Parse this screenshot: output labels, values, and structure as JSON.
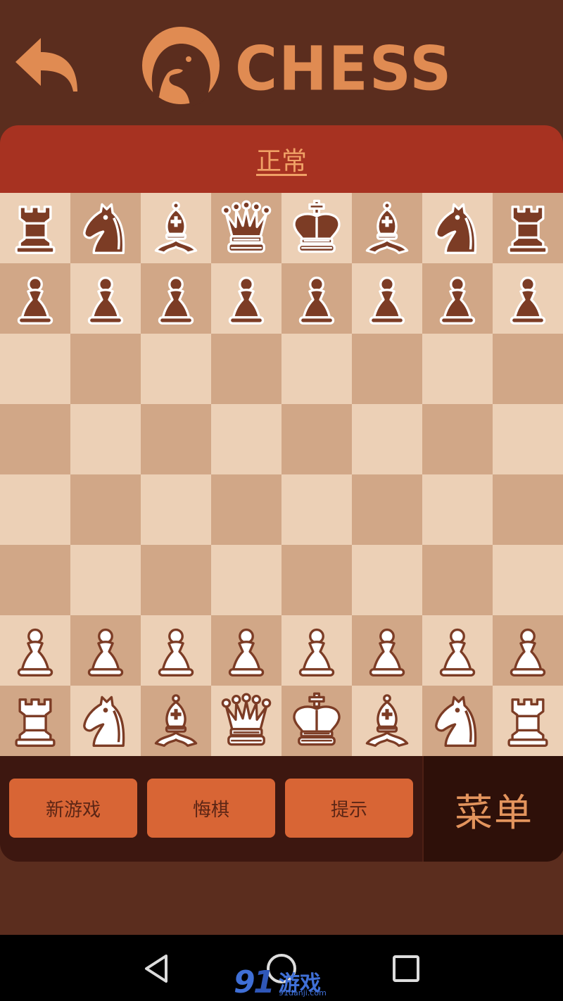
{
  "header": {
    "back_icon": "back-arrow-icon",
    "logo_icon": "horse-head-logo-icon",
    "logo_text": "CHESS"
  },
  "mode": {
    "label": "正常"
  },
  "board": {
    "rows": [
      [
        "br",
        "bn",
        "bb",
        "bq",
        "bk",
        "bb",
        "bn",
        "br"
      ],
      [
        "bp",
        "bp",
        "bp",
        "bp",
        "bp",
        "bp",
        "bp",
        "bp"
      ],
      [
        "",
        "",
        "",
        "",
        "",
        "",
        "",
        ""
      ],
      [
        "",
        "",
        "",
        "",
        "",
        "",
        "",
        ""
      ],
      [
        "",
        "",
        "",
        "",
        "",
        "",
        "",
        ""
      ],
      [
        "",
        "",
        "",
        "",
        "",
        "",
        "",
        ""
      ],
      [
        "wp",
        "wp",
        "wp",
        "wp",
        "wp",
        "wp",
        "wp",
        "wp"
      ],
      [
        "wr",
        "wn",
        "wb",
        "wq",
        "wk",
        "wb",
        "wn",
        "wr"
      ]
    ],
    "piece_names": {
      "r": "rook",
      "n": "knight",
      "b": "bishop",
      "q": "queen",
      "k": "king",
      "p": "pawn",
      "w": "white",
      "b_color": "black"
    }
  },
  "controls": {
    "new_game": "新游戏",
    "undo": "悔棋",
    "hint": "提示",
    "menu": "菜单"
  },
  "navbar": {
    "back_icon": "nav-back-icon",
    "home_icon": "nav-home-icon",
    "recents_icon": "nav-recents-icon"
  },
  "watermark": {
    "main": "游戏",
    "sub": "91danji.com"
  },
  "colors": {
    "background": "#5b2d1e",
    "accent": "#e08b52",
    "mode_bar": "#a73221",
    "light_square": "#ecd0b6",
    "dark_square": "#d1a787",
    "black_piece": "#7c3c25",
    "button": "#d86535"
  }
}
